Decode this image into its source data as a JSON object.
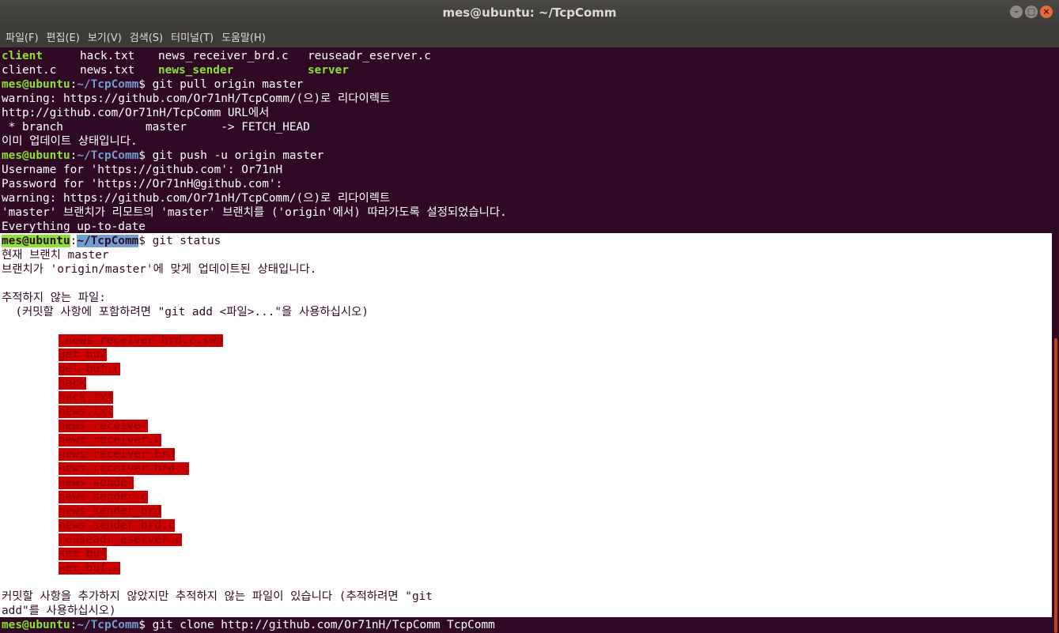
{
  "window": {
    "title": "mes@ubuntu: ~/TcpComm",
    "buttons": {
      "minimize": "–",
      "maximize": "□",
      "close": "×"
    }
  },
  "menu": [
    "파일(F)",
    "편집(E)",
    "보기(V)",
    "검색(S)",
    "터미널(T)",
    "도움말(H)"
  ],
  "terminal": {
    "ls_row1": [
      "client",
      "hack.txt",
      "news_receiver_brd.c",
      "reuseadr_eserver.c"
    ],
    "ls_row2": [
      "client.c",
      "news.txt",
      "news_sender",
      "server"
    ],
    "prompt_user": "mes@ubuntu",
    "prompt_sep": ":",
    "prompt_path": "~/TcpComm",
    "prompt_end": "$",
    "cmd_pull": " git pull origin master",
    "pull_out": [
      "warning: https://github.com/Or71nH/TcpComm/(으)로 리다이렉트",
      "http://github.com/Or71nH/TcpComm URL에서",
      " * branch            master     -> FETCH_HEAD",
      "이미 업데이트 상태입니다."
    ],
    "cmd_push": " git push -u origin master",
    "push_out": [
      "Username for 'https://github.com': Or71nH",
      "Password for 'https://Or71nH@github.com':",
      "warning: https://github.com/Or71nH/TcpComm/(으)로 리다이렉트",
      "'master' 브랜치가 리모트의 'master' 브랜치를 ('origin'에서) 따라가도록 설정되었습니다.",
      "Everything up-to-date"
    ],
    "cmd_status": " git status",
    "status_head": [
      "현재 브랜치 master",
      "브랜치가 'origin/master'에 맞게 업데이트된 상태입니다.",
      "",
      "추적하지 않는 파일:",
      "  (커밋할 사항에 포함하려면 \"git add <파일>...\"을 사용하십시오)"
    ],
    "untracked_files": [
      ".news_receiver_brd.c.swp",
      "get_buf",
      "get_buf.c",
      "hack",
      "hack.txt",
      "news.txt",
      "news_receiver",
      "news_receiver.c",
      "news_receiver_brd",
      "news_receiver_brd.c",
      "news_sender",
      "news_sender.c",
      "news_sender_brd",
      "news_sender_brd.c",
      "reuseadr_eserver.c",
      "set_buf",
      "set_buf.c"
    ],
    "status_tail": [
      "커밋할 사항을 추가하지 않았지만 추적하지 않는 파일이 있습니다 (추적하려면 \"git",
      "add\"를 사용하십시오)"
    ],
    "cmd_clone": " git clone http://github.com/Or71nH/TcpComm TcpComm"
  },
  "colors": {
    "background": "#300a24",
    "prompt_user": "#8ae234",
    "prompt_path": "#729fcf",
    "untracked": "#cc0000",
    "selection": "#ffffff",
    "scroll_thumb": "#c34113"
  }
}
